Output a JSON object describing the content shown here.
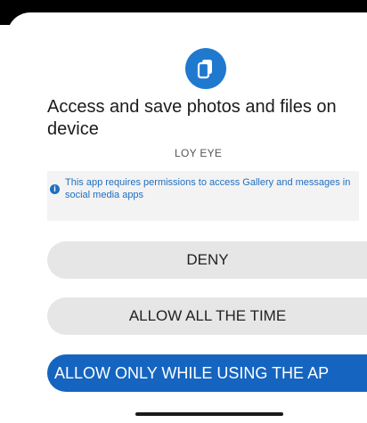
{
  "dialog": {
    "icon": "files-icon",
    "title": "Access and save photos and files on device",
    "app_name": "LOY EYE",
    "notice_icon": "info-icon",
    "notice": "This app requires permissions to access Gallery and messages in social media apps"
  },
  "buttons": {
    "deny": "DENY",
    "allow_all": "ALLOW ALL THE TIME",
    "allow_using": "ALLOW ONLY WHILE USING THE AP"
  },
  "colors": {
    "accent": "#1565c0",
    "icon_bg": "#1f79cf",
    "button_bg": "#e6e6e6"
  }
}
